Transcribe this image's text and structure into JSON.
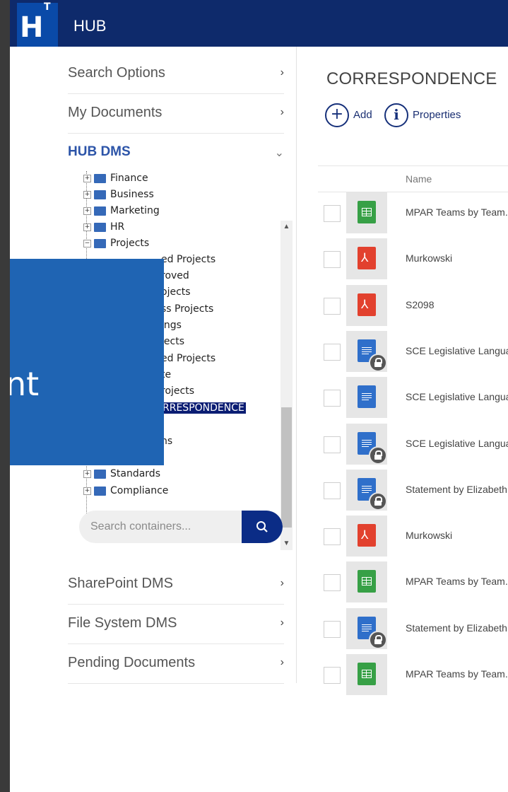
{
  "header": {
    "logo_main": "H",
    "logo_sup": "T",
    "title": "HUB"
  },
  "sidebar": {
    "search_options": "Search Options",
    "my_documents": "My Documents",
    "hub_dms": "HUB DMS",
    "chevron_right": "›",
    "chevron_down": "⌄",
    "tree": [
      {
        "label": "Finance",
        "expander": "+"
      },
      {
        "label": "Business",
        "expander": "+"
      },
      {
        "label": "Marketing",
        "expander": "+"
      },
      {
        "label": "HR",
        "expander": "+"
      },
      {
        "label": "Projects",
        "expander": "−"
      },
      {
        "label": "ed Projects",
        "expander": ""
      },
      {
        "label": "roved",
        "expander": ""
      },
      {
        "label": "ojects",
        "expander": ""
      },
      {
        "label": "ss Projects",
        "expander": ""
      },
      {
        "label": "ings",
        "expander": ""
      },
      {
        "label": "jects",
        "expander": ""
      },
      {
        "label": "ed Projects",
        "expander": ""
      },
      {
        "label": "te",
        "expander": ""
      },
      {
        "label": "rojects",
        "expander": ""
      },
      {
        "label": "RRESPONDENCE",
        "expander": "",
        "selected": true
      },
      {
        "label": "",
        "expander": ""
      },
      {
        "label": "ns",
        "expander": ""
      },
      {
        "label": "",
        "expander": ""
      },
      {
        "label": "Standards",
        "expander": "+"
      },
      {
        "label": "Compliance",
        "expander": "+"
      }
    ],
    "search_placeholder": "Search containers...",
    "sharepoint_dms": "SharePoint DMS",
    "file_system_dms": "File System DMS",
    "pending_documents": "Pending Documents"
  },
  "overlay": {
    "text": "nt"
  },
  "main": {
    "title": "CORRESPONDENCE",
    "add_label": "Add",
    "properties_label": "Properties",
    "column_name": "Name",
    "rows": [
      {
        "name": "MPAR Teams by Team.(",
        "type": "sheet",
        "locked": false
      },
      {
        "name": "Murkowski",
        "type": "pdf",
        "locked": false
      },
      {
        "name": "S2098",
        "type": "pdf",
        "locked": false
      },
      {
        "name": "SCE Legislative Languag",
        "type": "doc",
        "locked": true
      },
      {
        "name": "SCE Legislative Languag",
        "type": "doc",
        "locked": false
      },
      {
        "name": "SCE Legislative Languag",
        "type": "doc",
        "locked": true
      },
      {
        "name": "Statement by Elizabeth",
        "type": "doc",
        "locked": true
      },
      {
        "name": "Murkowski",
        "type": "pdf",
        "locked": false
      },
      {
        "name": "MPAR Teams by Team.(",
        "type": "sheet",
        "locked": false
      },
      {
        "name": "Statement by Elizabeth",
        "type": "doc",
        "locked": true
      },
      {
        "name": "MPAR Teams by Team.(",
        "type": "sheet",
        "locked": false
      }
    ]
  },
  "colors": {
    "header_bg": "#0e2a6b",
    "accent": "#2c54a8",
    "selected_bg": "#0b1d73",
    "overlay_bg": "#1f64b3"
  }
}
